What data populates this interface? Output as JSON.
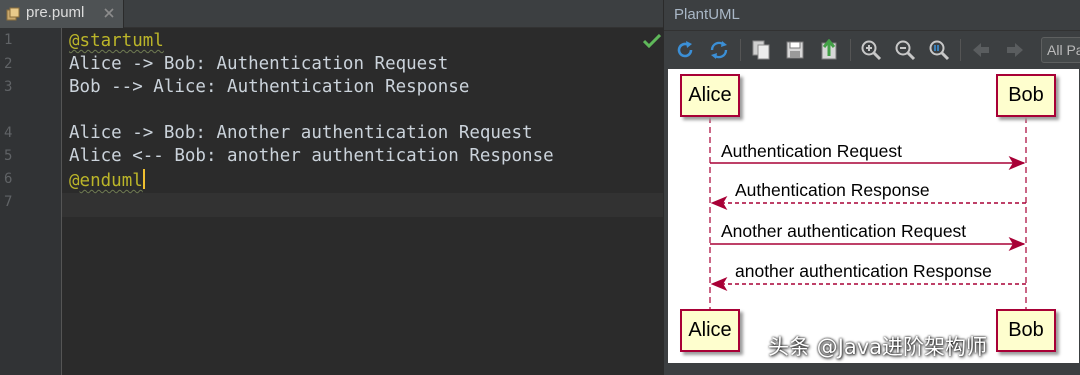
{
  "editor": {
    "tab_label": "pre.puml",
    "line_numbers": [
      "1",
      "2",
      "3",
      "4",
      "5",
      "6",
      "7"
    ],
    "lines": {
      "l1_keyword": "@startuml",
      "l2": "Alice -> Bob: Authentication Request",
      "l3": "Bob --> Alice: Authentication Response",
      "l4": "",
      "l5": "Alice -> Bob: Another authentication Request",
      "l6": "Alice <-- Bob: another authentication Response",
      "l7_at": "@",
      "l7_keyword": "enduml"
    },
    "syntax_colors": {
      "background": "#2b2b2b",
      "text": "#cbd3db",
      "keyword": "#bbb529",
      "gutter": "#313335"
    }
  },
  "plantuml": {
    "title": "PlantUML",
    "toolbar_icons": [
      "refresh-icon",
      "sync-icon",
      "copy-icon",
      "save-icon",
      "export-icon",
      "zoom-in-icon",
      "zoom-out-icon",
      "zoom-actual-icon",
      "prev-page-icon",
      "next-page-icon"
    ],
    "zoom_select": "All Pages",
    "diagram": {
      "participants": {
        "alice_top": "Alice",
        "bob_top": "Bob",
        "alice_bottom": "Alice",
        "bob_bottom": "Bob"
      },
      "messages": [
        "Authentication Request",
        "Authentication Response",
        "Another authentication Request",
        "another authentication Response"
      ],
      "colors": {
        "actor_fill": "#fefece",
        "actor_border": "#a80036",
        "arrow": "#a80036"
      }
    }
  },
  "watermark": "头条 @Java进阶架构师"
}
